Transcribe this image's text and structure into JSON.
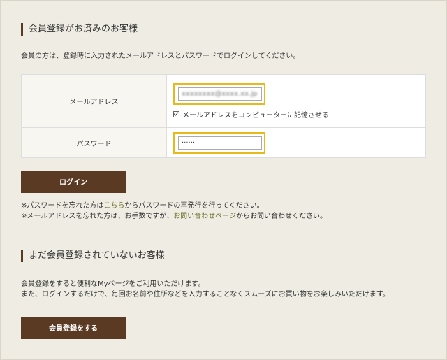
{
  "login_section": {
    "heading": "会員登録がお済みのお客様",
    "intro": "会員の方は、登録時に入力されたメールアドレスとパスワードでログインしてください。",
    "email_label": "メールアドレス",
    "email_value": "xxxxxxxx@xxxx.xx.jp",
    "remember_label": "メールアドレスをコンピューターに記憶させる",
    "remember_checked": true,
    "password_label": "パスワード",
    "password_value": "······",
    "login_button": "ログイン",
    "forgot_password": {
      "prefix": "※パスワードを忘れた方は",
      "link": "こちら",
      "suffix": "からパスワードの再発行を行ってください。"
    },
    "forgot_email": {
      "prefix": "※メールアドレスを忘れた方は、お手数ですが、",
      "link": "お問い合わせページ",
      "suffix": "からお問い合わせください。"
    }
  },
  "register_section": {
    "heading": "まだ会員登録されていないお客様",
    "line1": "会員登録をすると便利なMyページをご利用いただけます。",
    "line2": "また、ログインするだけで、毎回お名前や住所などを入力することなくスムーズにお買い物をお楽しみいただけます。",
    "register_button": "会員登録をする"
  },
  "colors": {
    "background": "#efece3",
    "button": "#5b3a24",
    "highlight": "#e8b91a",
    "link": "#6b6f2a"
  }
}
